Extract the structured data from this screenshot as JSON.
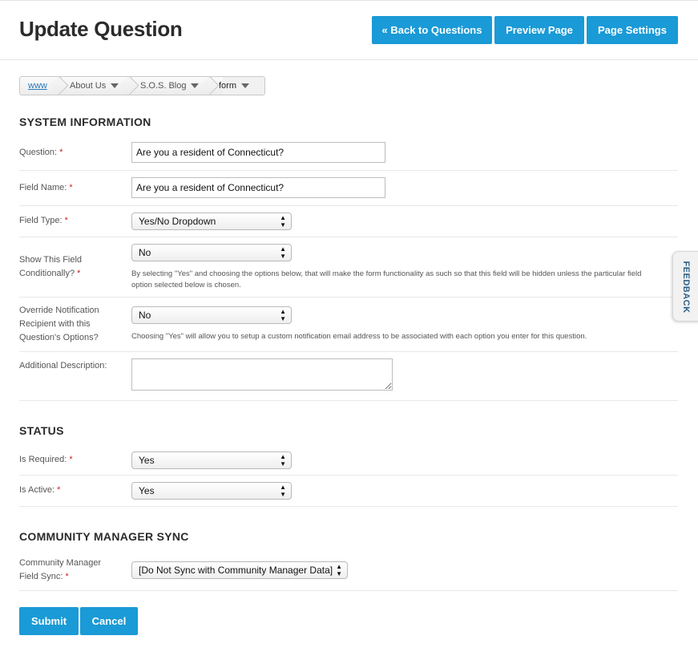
{
  "header": {
    "title": "Update Question",
    "back_label": "« Back to Questions",
    "preview_label": "Preview Page",
    "settings_label": "Page Settings"
  },
  "breadcrumb": {
    "home": "www",
    "items": [
      "About Us",
      "S.O.S. Blog",
      "form"
    ]
  },
  "system_information": {
    "title": "SYSTEM INFORMATION",
    "question": {
      "label": "Question:",
      "value": "Are you a resident of Connecticut?"
    },
    "field_name": {
      "label": "Field Name:",
      "value": "Are you a resident of Connecticut?"
    },
    "field_type": {
      "label": "Field Type:",
      "value": "Yes/No Dropdown"
    },
    "show_conditionally": {
      "label_line1": "Show This Field",
      "label_line2": "Conditionally?",
      "value": "No",
      "help_line1": "By selecting \"Yes\" and choosing the options below, that will make the form functionality as such so that this field will be hidden unless the particular field",
      "help_line2": "option selected below is chosen."
    },
    "override_notification": {
      "label_line1": "Override Notification",
      "label_line2": "Recipient with this",
      "label_line3": "Question's Options?",
      "value": "No",
      "help": "Choosing \"Yes\" will allow you to setup a custom notification email address to be associated with each option you enter for this question."
    },
    "additional_description": {
      "label": "Additional Description:",
      "value": ""
    }
  },
  "status": {
    "title": "STATUS",
    "is_required": {
      "label": "Is Required:",
      "value": "Yes"
    },
    "is_active": {
      "label": "Is Active:",
      "value": "Yes"
    }
  },
  "community_sync": {
    "title": "COMMUNITY MANAGER SYNC",
    "label_line1": "Community Manager",
    "label_line2": "Field Sync:",
    "value": "[Do Not Sync with Community Manager Data]"
  },
  "required_mark": "*",
  "actions": {
    "submit_label": "Submit",
    "cancel_label": "Cancel"
  },
  "feedback": {
    "label": "FEEDBACK"
  },
  "colors": {
    "accent": "#1a9ad6",
    "required": "#cc2222"
  }
}
